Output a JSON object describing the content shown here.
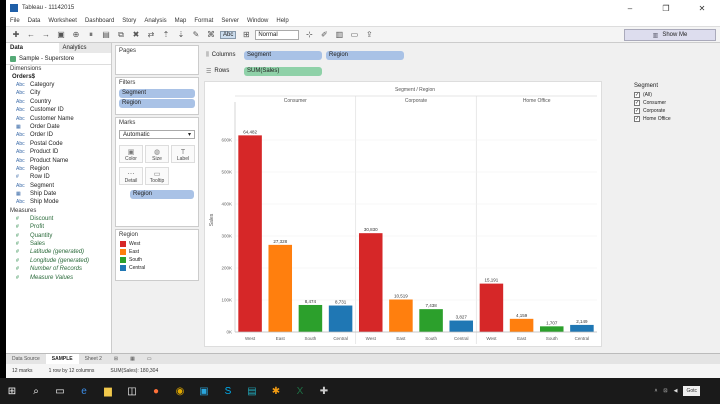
{
  "window": {
    "title": "Tableau - 11142015"
  },
  "menu": [
    "File",
    "Data",
    "Worksheet",
    "Dashboard",
    "Story",
    "Analysis",
    "Map",
    "Format",
    "Server",
    "Window",
    "Help"
  ],
  "toolbar": {
    "fit_option": "Normal",
    "abc": "Abc",
    "show_me": "Show Me"
  },
  "left_panel": {
    "tabs": [
      "Data",
      "Analytics"
    ],
    "datasource": "Sample - Superstore",
    "dimensions_label": "Dimensions",
    "table": "Orders$",
    "dimensions": [
      {
        "ico": "Abc",
        "name": "Category"
      },
      {
        "ico": "Abc",
        "name": "City"
      },
      {
        "ico": "Abc",
        "name": "Country"
      },
      {
        "ico": "Abc",
        "name": "Customer ID"
      },
      {
        "ico": "Abc",
        "name": "Customer Name"
      },
      {
        "ico": "▦",
        "name": "Order Date"
      },
      {
        "ico": "Abc",
        "name": "Order ID"
      },
      {
        "ico": "Abc",
        "name": "Postal Code"
      },
      {
        "ico": "Abc",
        "name": "Product ID"
      },
      {
        "ico": "Abc",
        "name": "Product Name"
      },
      {
        "ico": "Abc",
        "name": "Region"
      },
      {
        "ico": "#",
        "name": "Row ID"
      },
      {
        "ico": "Abc",
        "name": "Segment"
      },
      {
        "ico": "▦",
        "name": "Ship Date"
      },
      {
        "ico": "Abc",
        "name": "Ship Mode"
      }
    ],
    "measures_label": "Measures",
    "measures": [
      {
        "name": "Discount",
        "italic": false
      },
      {
        "name": "Profit",
        "italic": false
      },
      {
        "name": "Quantity",
        "italic": false
      },
      {
        "name": "Sales",
        "italic": false
      },
      {
        "name": "Latitude (generated)",
        "italic": true
      },
      {
        "name": "Longitude (generated)",
        "italic": true
      },
      {
        "name": "Number of Records",
        "italic": true
      },
      {
        "name": "Measure Values",
        "italic": true
      }
    ]
  },
  "cards": {
    "pages": "Pages",
    "filters": "Filters",
    "filter_pills": [
      "Segment",
      "Region"
    ],
    "marks": "Marks",
    "marks_type": "Automatic",
    "mark_buttons": [
      {
        "label": "Color",
        "g": "▣"
      },
      {
        "label": "Size",
        "g": "◍"
      },
      {
        "label": "Label",
        "g": "T"
      },
      {
        "label": "Detail",
        "g": "⋯"
      },
      {
        "label": "Tooltip",
        "g": "▭"
      }
    ],
    "marks_pill": "Region",
    "legend_title": "Region",
    "legend": [
      {
        "name": "West",
        "color": "#d62728"
      },
      {
        "name": "East",
        "color": "#ff7f0e"
      },
      {
        "name": "South",
        "color": "#2ca02c"
      },
      {
        "name": "Central",
        "color": "#1f77b4"
      }
    ]
  },
  "shelves": {
    "columns_label": "Columns",
    "columns": [
      "Segment",
      "Region"
    ],
    "rows_label": "Rows",
    "rows": [
      "SUM(Sales)"
    ]
  },
  "segment_legend": {
    "title": "Segment",
    "items": [
      "(All)",
      "Consumer",
      "Corporate",
      "Home Office"
    ]
  },
  "chart_data": {
    "type": "bar",
    "title": "Segment / Region",
    "ylabel": "Sales",
    "ylim": [
      0,
      700000
    ],
    "yticks": [
      "0K",
      "100K",
      "200K",
      "300K",
      "400K",
      "500K",
      "600K"
    ],
    "ytick_values": [
      0,
      100000,
      200000,
      300000,
      400000,
      500000,
      600000
    ],
    "groups": [
      "Consumer",
      "Corporate",
      "Home Office"
    ],
    "categories": [
      "West",
      "East",
      "South",
      "Central"
    ],
    "colors": [
      "#d62728",
      "#ff7f0e",
      "#2ca02c",
      "#1f77b4"
    ],
    "bars": [
      {
        "group": "Consumer",
        "category": "West",
        "value": 614482,
        "label": "64,482"
      },
      {
        "group": "Consumer",
        "category": "East",
        "value": 272328,
        "label": "27,328"
      },
      {
        "group": "Consumer",
        "category": "South",
        "value": 84474,
        "label": "8,474"
      },
      {
        "group": "Consumer",
        "category": "Central",
        "value": 82731,
        "label": "8,731"
      },
      {
        "group": "Corporate",
        "category": "West",
        "value": 308830,
        "label": "30,830"
      },
      {
        "group": "Corporate",
        "category": "East",
        "value": 101519,
        "label": "10,519"
      },
      {
        "group": "Corporate",
        "category": "South",
        "value": 71438,
        "label": "7,438"
      },
      {
        "group": "Corporate",
        "category": "Central",
        "value": 35827,
        "label": "3,827"
      },
      {
        "group": "Home Office",
        "category": "West",
        "value": 151191,
        "label": "15,191"
      },
      {
        "group": "Home Office",
        "category": "East",
        "value": 41159,
        "label": "4,159"
      },
      {
        "group": "Home Office",
        "category": "South",
        "value": 17707,
        "label": "1,707"
      },
      {
        "group": "Home Office",
        "category": "Central",
        "value": 22149,
        "label": "2,149"
      }
    ]
  },
  "sheet_tabs": [
    "Data Source",
    "SAMPLE",
    "Sheet 2"
  ],
  "status": {
    "marks": "12 marks",
    "rows": "1 row by 12 columns",
    "sum": "SUM(Sales): 180,304"
  },
  "tray": {
    "gotcha": "Gotc"
  }
}
